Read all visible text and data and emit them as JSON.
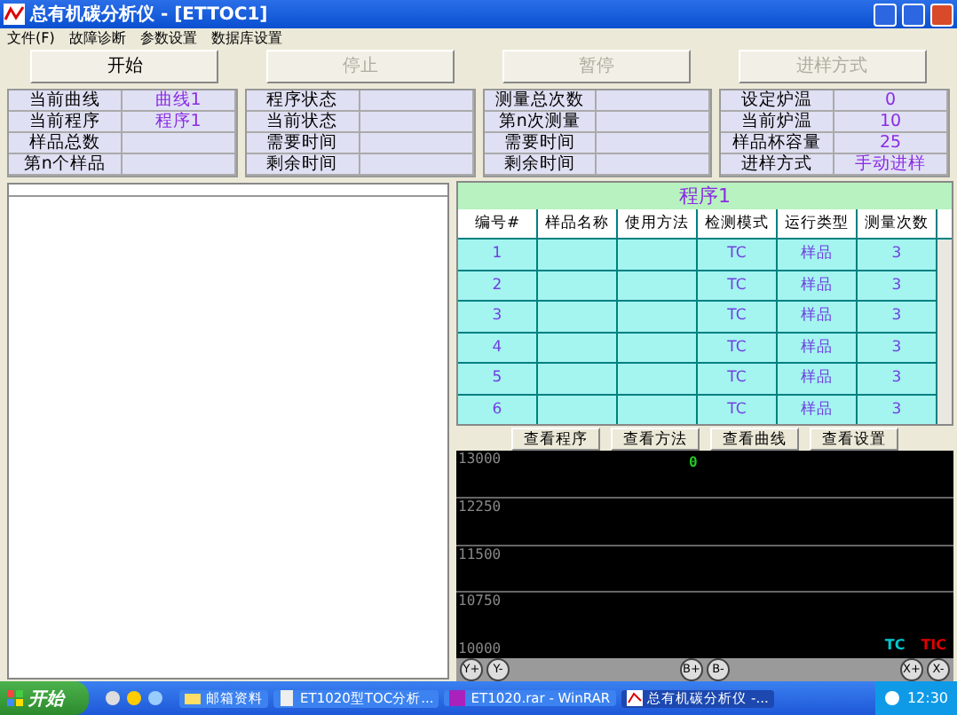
{
  "window": {
    "title": "总有机碳分析仪 - [ETTOC1]"
  },
  "menu": [
    "文件(F)",
    "故障诊断",
    "参数设置",
    "数据库设置"
  ],
  "buttons": [
    {
      "label": "开始",
      "disabled": false
    },
    {
      "label": "停止",
      "disabled": true
    },
    {
      "label": "暂停",
      "disabled": true
    },
    {
      "label": "进样方式",
      "disabled": true
    }
  ],
  "info_groups": [
    {
      "rows": [
        {
          "label": "当前曲线",
          "value": "曲线1"
        },
        {
          "label": "当前程序",
          "value": "程序1"
        },
        {
          "label": "样品总数"
        },
        {
          "label": "第n个样品"
        }
      ]
    },
    {
      "rows": [
        {
          "label": "程序状态"
        },
        {
          "label": "当前状态"
        },
        {
          "label": "需要时间"
        },
        {
          "label": "剩余时间"
        }
      ]
    },
    {
      "rows": [
        {
          "label": "测量总次数"
        },
        {
          "label": "第n次测量"
        },
        {
          "label": "需要时间"
        },
        {
          "label": "剩余时间"
        }
      ]
    },
    {
      "rows": [
        {
          "label": "设定炉温",
          "value": "0"
        },
        {
          "label": "当前炉温",
          "value": "10"
        },
        {
          "label": "样品杯容量",
          "value": "25"
        },
        {
          "label": "进样方式",
          "value": "手动进样"
        }
      ]
    }
  ],
  "table": {
    "title": "程序1",
    "columns": [
      "编号#",
      "样品名称",
      "使用方法",
      "检测模式",
      "运行类型",
      "测量次数"
    ],
    "rows": [
      [
        "1",
        "",
        "",
        "TC",
        "样品",
        "3"
      ],
      [
        "2",
        "",
        "",
        "TC",
        "样品",
        "3"
      ],
      [
        "3",
        "",
        "",
        "TC",
        "样品",
        "3"
      ],
      [
        "4",
        "",
        "",
        "TC",
        "样品",
        "3"
      ],
      [
        "5",
        "",
        "",
        "TC",
        "样品",
        "3"
      ],
      [
        "6",
        "",
        "",
        "TC",
        "样品",
        "3"
      ]
    ]
  },
  "view_buttons": [
    "查看程序",
    "查看方法",
    "查看曲线",
    "查看设置"
  ],
  "chart": {
    "y_labels": [
      "13000",
      "12250",
      "11500",
      "10750",
      "10000"
    ],
    "marker": "0",
    "legend": [
      {
        "label": "TC",
        "color": "#00c8d0"
      },
      {
        "label": "TIC",
        "color": "#e00000"
      }
    ],
    "controls": [
      "Y+",
      "Y-",
      "B+",
      "B-",
      "X+",
      "X-"
    ]
  },
  "taskbar": {
    "start": "开始",
    "tasks": [
      {
        "label": "邮箱资料",
        "selected": false,
        "kind": "folder"
      },
      {
        "label": "ET1020型TOC分析...",
        "selected": false,
        "kind": "doc"
      },
      {
        "label": "ET1020.rar - WinRAR",
        "selected": false,
        "kind": "rar"
      },
      {
        "label": "总有机碳分析仪 -...",
        "selected": true,
        "kind": "app"
      }
    ],
    "clock": "12:30"
  }
}
